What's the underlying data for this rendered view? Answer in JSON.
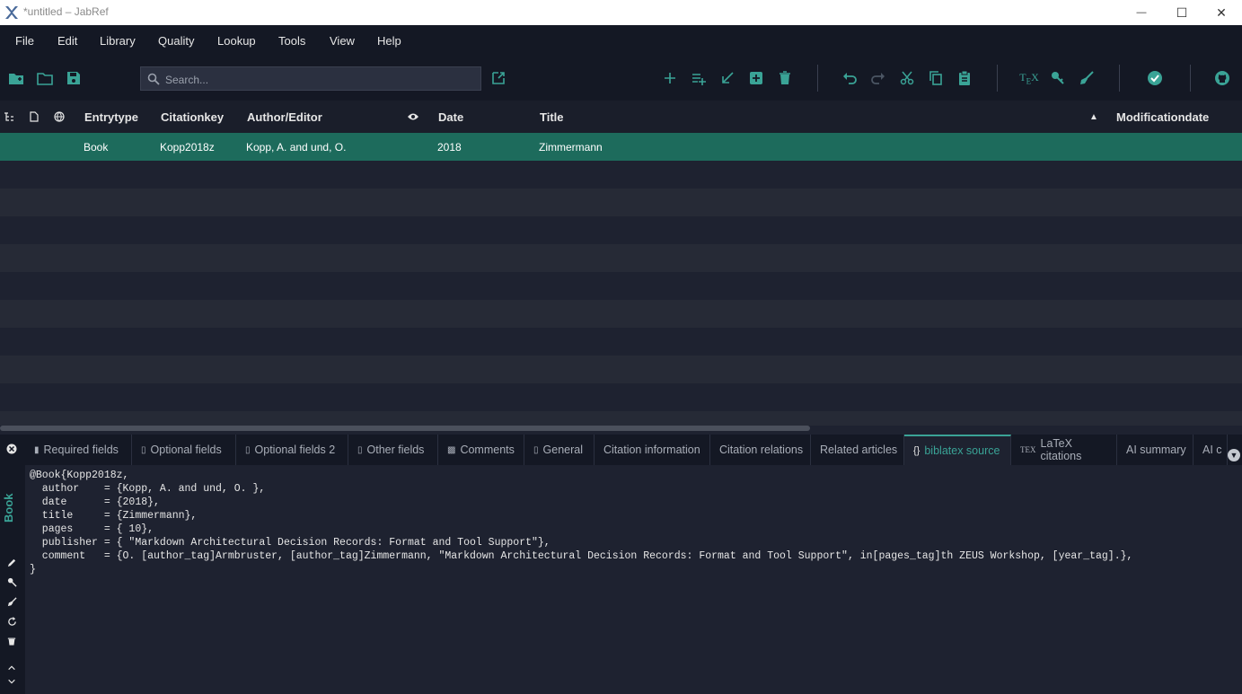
{
  "window": {
    "title": "*untitled – JabRef",
    "minimize": "—",
    "maximize": "☐",
    "close": "✕"
  },
  "menu": [
    "File",
    "Edit",
    "Library",
    "Quality",
    "Lookup",
    "Tools",
    "View",
    "Help"
  ],
  "search": {
    "placeholder": "Search..."
  },
  "colors": {
    "accent": "#3aa396",
    "selected_row": "#1d6b5c",
    "toolbar_bg": "#141824",
    "panel_bg": "#1e2230"
  },
  "table": {
    "columns": [
      "Entrytype",
      "Citationkey",
      "Author/Editor",
      "Date",
      "Title",
      "Modificationdate"
    ],
    "sort_indicator": "▲",
    "rows": [
      {
        "entrytype": "Book",
        "citationkey": "Kopp2018z",
        "author": "Kopp, A. and und, O.",
        "date": "2018",
        "title": "Zimmermann",
        "modificationdate": ""
      }
    ]
  },
  "entry_editor": {
    "entry_type_label": "Book",
    "tabs": [
      {
        "label": "Required fields",
        "icon": "tag-icon"
      },
      {
        "label": "Optional fields",
        "icon": "tag-outline-icon"
      },
      {
        "label": "Optional fields 2",
        "icon": "tag-outline-icon"
      },
      {
        "label": "Other fields",
        "icon": "tag-outline-icon"
      },
      {
        "label": "Comments",
        "icon": "comment-icon"
      },
      {
        "label": "General",
        "icon": "tag-outline-icon"
      },
      {
        "label": "Citation information",
        "icon": ""
      },
      {
        "label": "Citation relations",
        "icon": ""
      },
      {
        "label": "Related articles",
        "icon": ""
      },
      {
        "label": "biblatex source",
        "icon": "braces-icon",
        "prefix": "{}"
      },
      {
        "label": "LaTeX citations",
        "icon": "tex-icon"
      },
      {
        "label": "AI summary",
        "icon": ""
      },
      {
        "label": "AI c",
        "icon": ""
      }
    ],
    "active_tab": "biblatex source",
    "source": "@Book{Kopp2018z,\n  author    = {Kopp, A. and und, O. },\n  date      = {2018},\n  title     = {Zimmermann},\n  pages     = { 10},\n  publisher = { \"Markdown Architectural Decision Records: Format and Tool Support\"},\n  comment   = {O. [author_tag]Armbruster, [author_tag]Zimmermann, \"Markdown Architectural Decision Records: Format and Tool Support\", in[pages_tag]th ZEUS Workshop, [year_tag].},\n}"
  }
}
